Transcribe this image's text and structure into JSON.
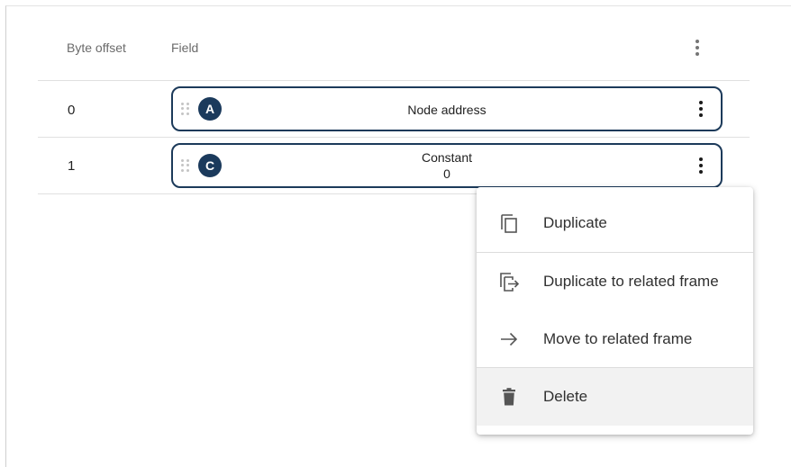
{
  "table": {
    "headers": {
      "byte_offset": "Byte offset",
      "field": "Field"
    },
    "rows": [
      {
        "offset": "0",
        "badge": "A",
        "label": "Node address",
        "sublabel": ""
      },
      {
        "offset": "1",
        "badge": "C",
        "label": "Constant",
        "sublabel": "0"
      }
    ]
  },
  "context_menu": {
    "items": [
      {
        "label": "Duplicate",
        "icon": "duplicate-icon"
      },
      {
        "label": "Duplicate to related frame",
        "icon": "duplicate-to-frame-icon"
      },
      {
        "label": "Move to related frame",
        "icon": "arrow-right-icon"
      },
      {
        "label": "Delete",
        "icon": "trash-icon"
      }
    ],
    "highlighted_item": "Delete"
  },
  "colors": {
    "chip_border": "#1c3a5a",
    "badge_bg": "#1b3a5c",
    "menu_highlight": "#f2f2f2"
  }
}
